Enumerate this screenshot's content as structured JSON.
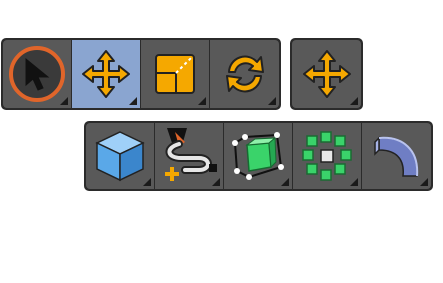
{
  "toolbars": [
    {
      "name": "transform-tools",
      "tools": [
        {
          "icon": "select-cursor-icon",
          "active": false
        },
        {
          "icon": "move-icon",
          "active": true
        },
        {
          "icon": "scale-icon",
          "active": false
        },
        {
          "icon": "rotate-icon",
          "active": false
        }
      ]
    },
    {
      "name": "transform-single",
      "tools": [
        {
          "icon": "move-icon",
          "active": false
        }
      ]
    },
    {
      "name": "add-tools",
      "tools": [
        {
          "icon": "add-cube-icon",
          "active": false
        },
        {
          "icon": "draw-curve-icon",
          "active": false
        },
        {
          "icon": "cage-edit-icon",
          "active": false
        },
        {
          "icon": "scatter-icon",
          "active": false
        },
        {
          "icon": "spin-surface-icon",
          "active": false
        }
      ]
    }
  ],
  "colors": {
    "toolbar_bg": "#2b2b2b",
    "button_bg": "#595959",
    "button_active_bg": "#8aa5d0",
    "accent_orange": "#f5a800",
    "cube_blue": "#5aa8e8",
    "cube_green": "#3ad36a"
  }
}
